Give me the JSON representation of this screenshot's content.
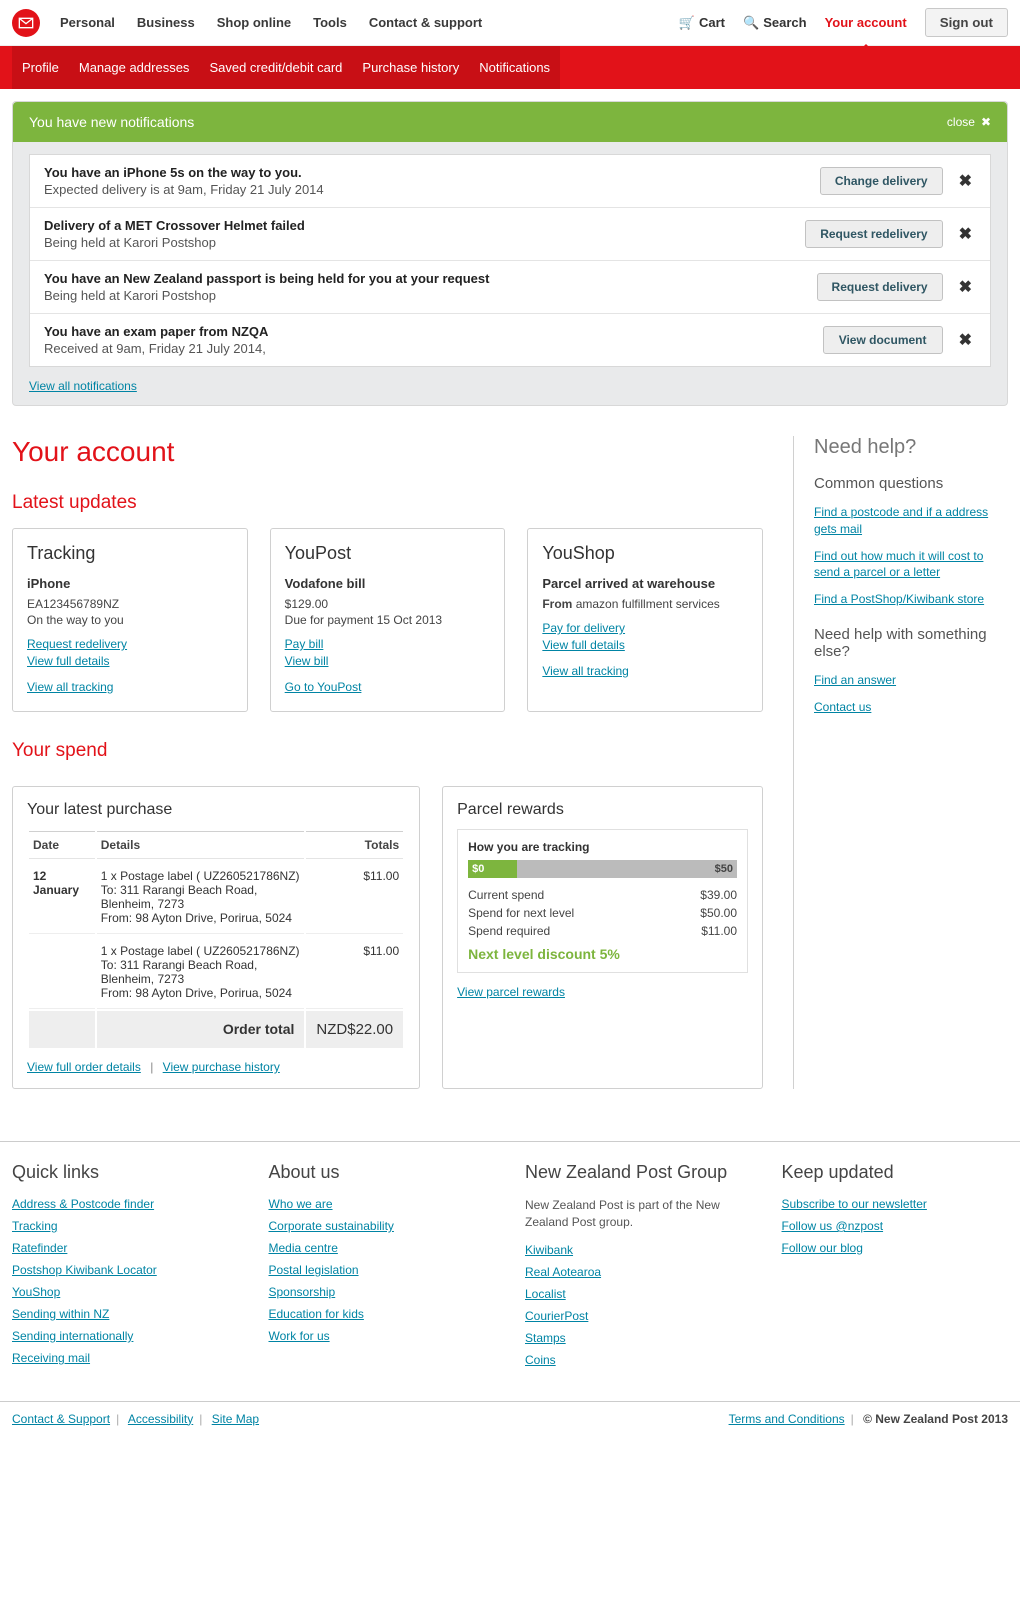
{
  "header": {
    "nav": [
      "Personal",
      "Business",
      "Shop online",
      "Tools",
      "Contact & support"
    ],
    "cart": "Cart",
    "search": "Search",
    "account": "Your account",
    "signout": "Sign out"
  },
  "subnav": [
    "Profile",
    "Manage addresses",
    "Saved credit/debit card",
    "Purchase history",
    "Notifications"
  ],
  "notifBanner": {
    "title": "You have new notifications",
    "close": "close"
  },
  "notifications": [
    {
      "title": "You have an iPhone 5s on the way to you.",
      "sub": "Expected delivery is at 9am, Friday 21 July 2014",
      "btn": "Change delivery"
    },
    {
      "title": "Delivery of a MET Crossover Helmet failed",
      "sub": "Being held at Karori Postshop",
      "btn": "Request redelivery"
    },
    {
      "title": "You have an New Zealand passport is being held for you at your request",
      "sub": "Being held at Karori Postshop",
      "btn": "Request delivery"
    },
    {
      "title": "You have an exam paper from NZQA",
      "sub": "Received at 9am, Friday 21 July 2014,",
      "btn": "View document"
    }
  ],
  "viewAllNotif": "View all notifications",
  "pageTitle": "Your account",
  "latestUpdates": {
    "heading": "Latest updates",
    "tracking": {
      "title": "Tracking",
      "item": "iPhone",
      "num": "EA123456789NZ",
      "status": "On  the way to you",
      "links": [
        "Request redelivery",
        "View full details"
      ],
      "all": "View all tracking"
    },
    "youpost": {
      "title": "YouPost",
      "item": "Vodafone bill",
      "amount": "$129.00",
      "due": "Due for payment 15 Oct 2013",
      "links": [
        "Pay bill",
        "View bill"
      ],
      "all": "Go to YouPost"
    },
    "youshop": {
      "title": "YouShop",
      "item": "Parcel arrived at warehouse",
      "fromLabel": "From",
      "from": "amazon fulfillment services",
      "links": [
        "Pay for delivery",
        "View full details"
      ],
      "all": "View all tracking"
    }
  },
  "yourSpend": {
    "heading": "Your spend",
    "latestPurchase": {
      "title": "Your latest purchase",
      "cols": {
        "date": "Date",
        "details": "Details",
        "totals": "Totals"
      },
      "rows": [
        {
          "date": "12 January",
          "line1": "1 x Postage label ( UZ260521786NZ)",
          "line2": "To: 311 Rarangi Beach Road, Blenheim, 7273",
          "line3": "From: 98 Ayton Drive, Porirua, 5024",
          "total": "$11.00"
        },
        {
          "date": "",
          "line1": "1 x Postage label ( UZ260521786NZ)",
          "line2": "To: 311 Rarangi Beach Road, Blenheim, 7273",
          "line3": "From: 98 Ayton Drive, Porirua, 5024",
          "total": "$11.00"
        }
      ],
      "orderTotalLabel": "Order total",
      "orderTotal": "NZD$22.00",
      "links": [
        "View full order details",
        "View purchase history"
      ]
    },
    "rewards": {
      "title": "Parcel rewards",
      "tracking": "How you are tracking",
      "min": "$0",
      "max": "$50",
      "lines": [
        {
          "label": "Current spend",
          "val": "$39.00"
        },
        {
          "label": "Spend for next level",
          "val": "$50.00"
        },
        {
          "label": "Spend required",
          "val": "$11.00"
        }
      ],
      "next": "Next level  discount 5%",
      "link": "View parcel rewards",
      "progressPct": 18
    }
  },
  "help": {
    "title": "Need help?",
    "common": {
      "title": "Common questions",
      "links": [
        "Find a postcode and if a address gets mail",
        "Find out how much it will cost to send a parcel or a letter",
        "Find a PostShop/Kiwibank store"
      ]
    },
    "else": {
      "title": "Need help with something else?",
      "links": [
        "Find an answer",
        "Contact us"
      ]
    }
  },
  "footer": {
    "quick": {
      "title": "Quick links",
      "links": [
        "Address & Postcode finder",
        "Tracking",
        "Ratefinder",
        "Postshop Kiwibank Locator",
        "YouShop",
        "Sending within NZ",
        "Sending internationally",
        "Receiving mail"
      ]
    },
    "about": {
      "title": "About us",
      "links": [
        "Who we are",
        "Corporate sustainability",
        "Media centre",
        "Postal legislation",
        "Sponsorship",
        "Education for kids",
        "Work for us"
      ]
    },
    "group": {
      "title": "New Zealand Post Group",
      "text": "New Zealand Post is part of the New Zealand Post group.",
      "links": [
        "Kiwibank",
        "Real Aotearoa",
        "Localist",
        "CourierPost",
        "Stamps",
        "Coins"
      ]
    },
    "updated": {
      "title": "Keep updated",
      "links": [
        "Subscribe to our newsletter",
        "Follow us @nzpost",
        "Follow our blog"
      ]
    },
    "bottom": {
      "links": [
        "Contact & Support",
        "Accessibility",
        "Site Map"
      ],
      "terms": "Terms and Conditions",
      "copy": "© New Zealand Post 2013"
    }
  }
}
